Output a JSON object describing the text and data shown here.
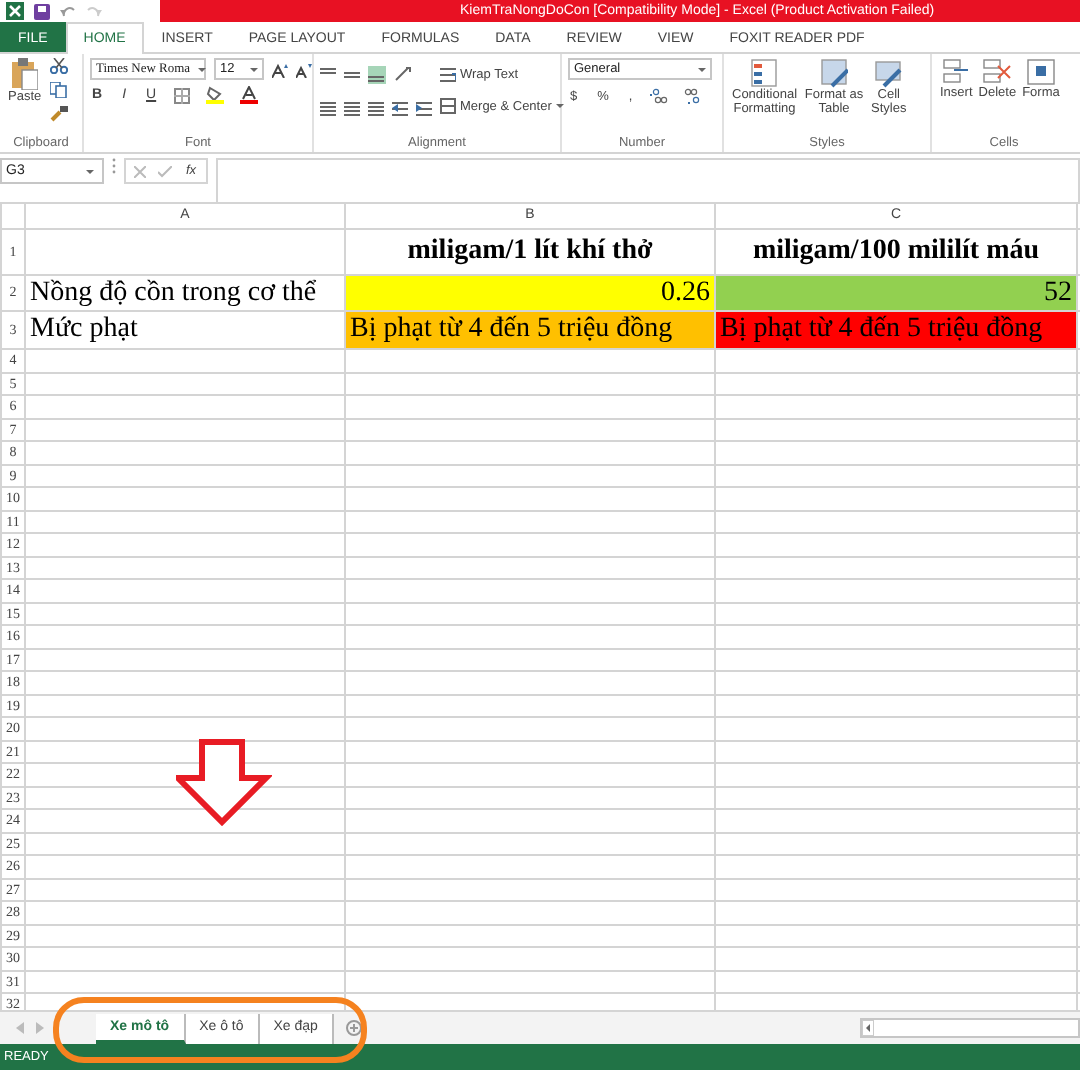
{
  "title_bar": {
    "title": "KiemTraNongDoCon  [Compatibility Mode] - Excel (Product Activation Failed)"
  },
  "ribbon_tabs": [
    {
      "label": "FILE",
      "kind": "file",
      "selected": false
    },
    {
      "label": "HOME",
      "kind": "tab",
      "selected": true
    },
    {
      "label": "INSERT",
      "kind": "tab",
      "selected": false
    },
    {
      "label": "PAGE LAYOUT",
      "kind": "tab",
      "selected": false
    },
    {
      "label": "FORMULAS",
      "kind": "tab",
      "selected": false
    },
    {
      "label": "DATA",
      "kind": "tab",
      "selected": false
    },
    {
      "label": "REVIEW",
      "kind": "tab",
      "selected": false
    },
    {
      "label": "VIEW",
      "kind": "tab",
      "selected": false
    },
    {
      "label": "FOXIT READER PDF",
      "kind": "tab",
      "selected": false
    }
  ],
  "ribbon": {
    "clipboard": {
      "label": "Clipboard",
      "paste": "Paste"
    },
    "font": {
      "label": "Font",
      "name": "Times New Roma",
      "size": "12",
      "bold": "B",
      "italic": "I",
      "underline": "U"
    },
    "alignment": {
      "label": "Alignment",
      "wrap_text": "Wrap Text",
      "merge_center": "Merge & Center"
    },
    "number": {
      "label": "Number",
      "format": "General",
      "currency": "$",
      "percent": "%",
      "comma": ","
    },
    "styles": {
      "label": "Styles",
      "buttons": [
        "Conditional Formatting",
        "Format as Table",
        "Cell Styles"
      ]
    },
    "cells": {
      "label": "Cells",
      "buttons": [
        "Insert",
        "Delete",
        "Forma"
      ]
    }
  },
  "formula_bar": {
    "name_box": "G3",
    "function": "fx"
  },
  "columns": [
    "A",
    "B",
    "C"
  ],
  "rows": [
    {
      "header": "1",
      "cells": [
        null,
        {
          "text": "miligam/1 lít khí thở",
          "kind": "heading"
        },
        {
          "text": "miligam/100 mililít máu",
          "kind": "heading"
        }
      ]
    },
    {
      "header": "2",
      "cells": [
        {
          "text": "Nồng độ cồn trong cơ thể",
          "kind": "text"
        },
        {
          "text": "0.26",
          "kind": "number",
          "color": "#ffff00"
        },
        {
          "text": "52",
          "kind": "number",
          "color": "#92d050"
        }
      ]
    },
    {
      "header": "3",
      "cells": [
        {
          "text": "Mức phạt",
          "kind": "text"
        },
        {
          "text": "Bị phạt từ 4 đến 5 triệu đồng",
          "kind": "text",
          "color": "#ffc000"
        },
        {
          "text": "Bị phạt từ 4 đến 5 triệu đồng",
          "kind": "text",
          "color": "#ff0000"
        }
      ]
    },
    {
      "header": "4"
    },
    {
      "header": "5"
    },
    {
      "header": "6"
    },
    {
      "header": "7"
    },
    {
      "header": "8"
    },
    {
      "header": "9"
    },
    {
      "header": "10"
    },
    {
      "header": "11"
    },
    {
      "header": "12"
    },
    {
      "header": "13"
    },
    {
      "header": "14"
    },
    {
      "header": "15"
    },
    {
      "header": "16"
    },
    {
      "header": "17"
    },
    {
      "header": "18"
    },
    {
      "header": "19"
    },
    {
      "header": "20"
    },
    {
      "header": "21"
    },
    {
      "header": "22"
    },
    {
      "header": "23"
    },
    {
      "header": "24"
    },
    {
      "header": "25"
    },
    {
      "header": "26"
    },
    {
      "header": "27"
    },
    {
      "header": "28"
    },
    {
      "header": "29"
    },
    {
      "header": "30"
    },
    {
      "header": "31"
    },
    {
      "header": "32"
    }
  ],
  "sheet_tabs": [
    {
      "label": "Xe mô tô",
      "selected": true
    },
    {
      "label": "Xe ô tô",
      "selected": false
    },
    {
      "label": "Xe đạp",
      "selected": false
    }
  ],
  "status_bar": {
    "text": "READY"
  }
}
